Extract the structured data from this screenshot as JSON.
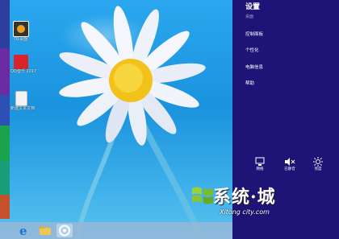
{
  "desktop": {
    "icons": [
      {
        "name": "app-1",
        "label": "01桌面"
      },
      {
        "name": "app-2",
        "label": "QQ音乐 2017"
      },
      {
        "name": "file",
        "label": "新建文本文档"
      }
    ]
  },
  "taskbar": {
    "buttons": [
      "ie-icon",
      "folder-icon",
      "app-icon"
    ]
  },
  "settings": {
    "title": "设置",
    "subtitle": "桌面",
    "items": [
      "控制面板",
      "个性化",
      "电脑信息",
      "帮助"
    ],
    "quick": [
      {
        "icon": "network-icon",
        "label": "网络"
      },
      {
        "icon": "volume-icon",
        "label": "已静音"
      },
      {
        "icon": "brightness-icon",
        "label": "亮度"
      }
    ]
  },
  "watermark": {
    "text": "系统·城",
    "sub": "Xitong city.com"
  },
  "colors": {
    "charm_bg": "#1e1477",
    "desktop_sky": "#1a93dd",
    "taskbar": "#96b9d7"
  }
}
